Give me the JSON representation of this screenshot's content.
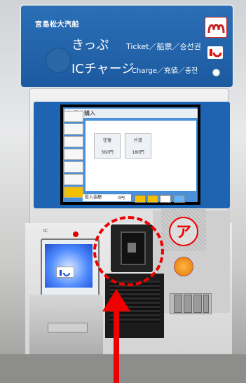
{
  "header": {
    "company": "宮島松大汽船",
    "ticket_main": "きっぷ",
    "ticket_sub": "Ticket／船票／승선권",
    "ic_main": "ICチャージ",
    "ic_sub": "Charge／充値／충전"
  },
  "screen": {
    "title": "お券を購入",
    "fares": [
      {
        "label": "往復",
        "price": "360円"
      },
      {
        "label": "片道",
        "price": "180円"
      }
    ],
    "amount_label": "投入金額",
    "amount_value": "0円"
  },
  "annotation": {
    "marker_label": "ア",
    "marker_color": "#e00000"
  },
  "colors": {
    "header_blue": "#1c5aa0",
    "annotation_red": "#e00000"
  }
}
